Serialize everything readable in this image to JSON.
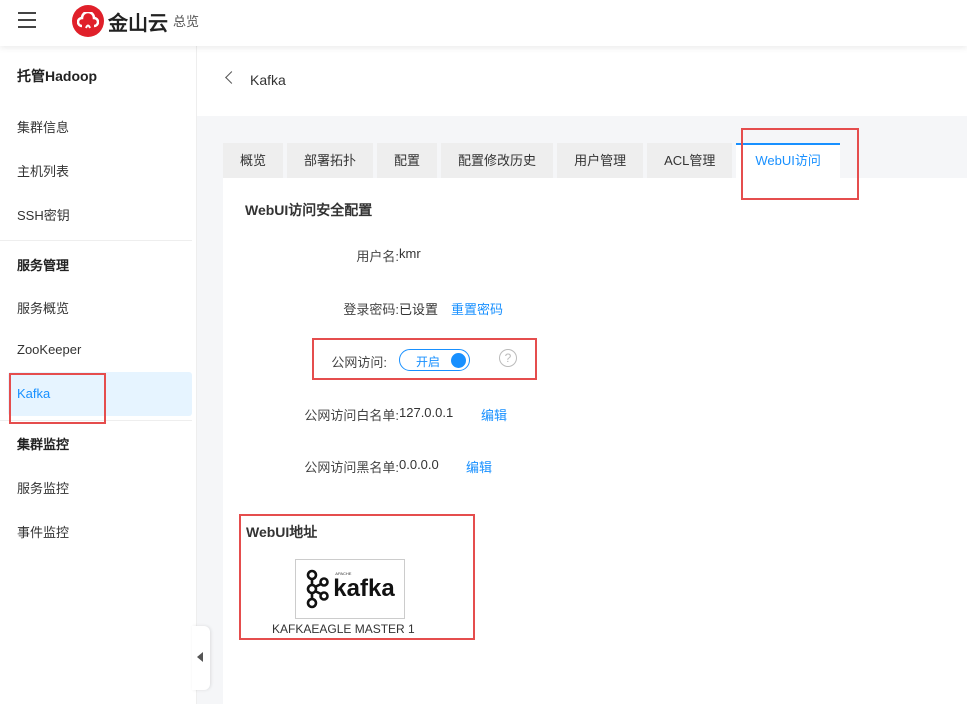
{
  "header": {
    "brand": "金山云",
    "nav_overview": "总览"
  },
  "sidebar": {
    "title": "托管Hadoop",
    "items": [
      "集群信息",
      "主机列表",
      "SSH密钥"
    ],
    "section1": "服务管理",
    "service_items": [
      "服务概览",
      "ZooKeeper",
      "Kafka"
    ],
    "section2": "集群监控",
    "monitor_items": [
      "服务监控",
      "事件监控"
    ]
  },
  "breadcrumb": {
    "title": "Kafka"
  },
  "tabs": [
    "概览",
    "部署拓扑",
    "配置",
    "配置修改历史",
    "用户管理",
    "ACL管理",
    "WebUI访问"
  ],
  "security": {
    "heading": "WebUI访问安全配置",
    "username_label": "用户名:",
    "username": "kmr",
    "password_label": "登录密码:",
    "password_status": "已设置",
    "reset_password": "重置密码",
    "public_label": "公网访问:",
    "public_toggle": "开启",
    "whitelist_label": "公网访问白名单:",
    "whitelist": "127.0.0.1",
    "blacklist_label": "公网访问黑名单:",
    "blacklist": "0.0.0.0",
    "edit": "编辑"
  },
  "webui": {
    "heading": "WebUI地址",
    "logo_apache": "APACHE",
    "logo_text": "kafka",
    "link_name": "KAFKAEAGLE MASTER 1"
  },
  "colors": {
    "accent": "#1890ff",
    "brand": "#e0202a",
    "highlight": "#e54d4d"
  }
}
